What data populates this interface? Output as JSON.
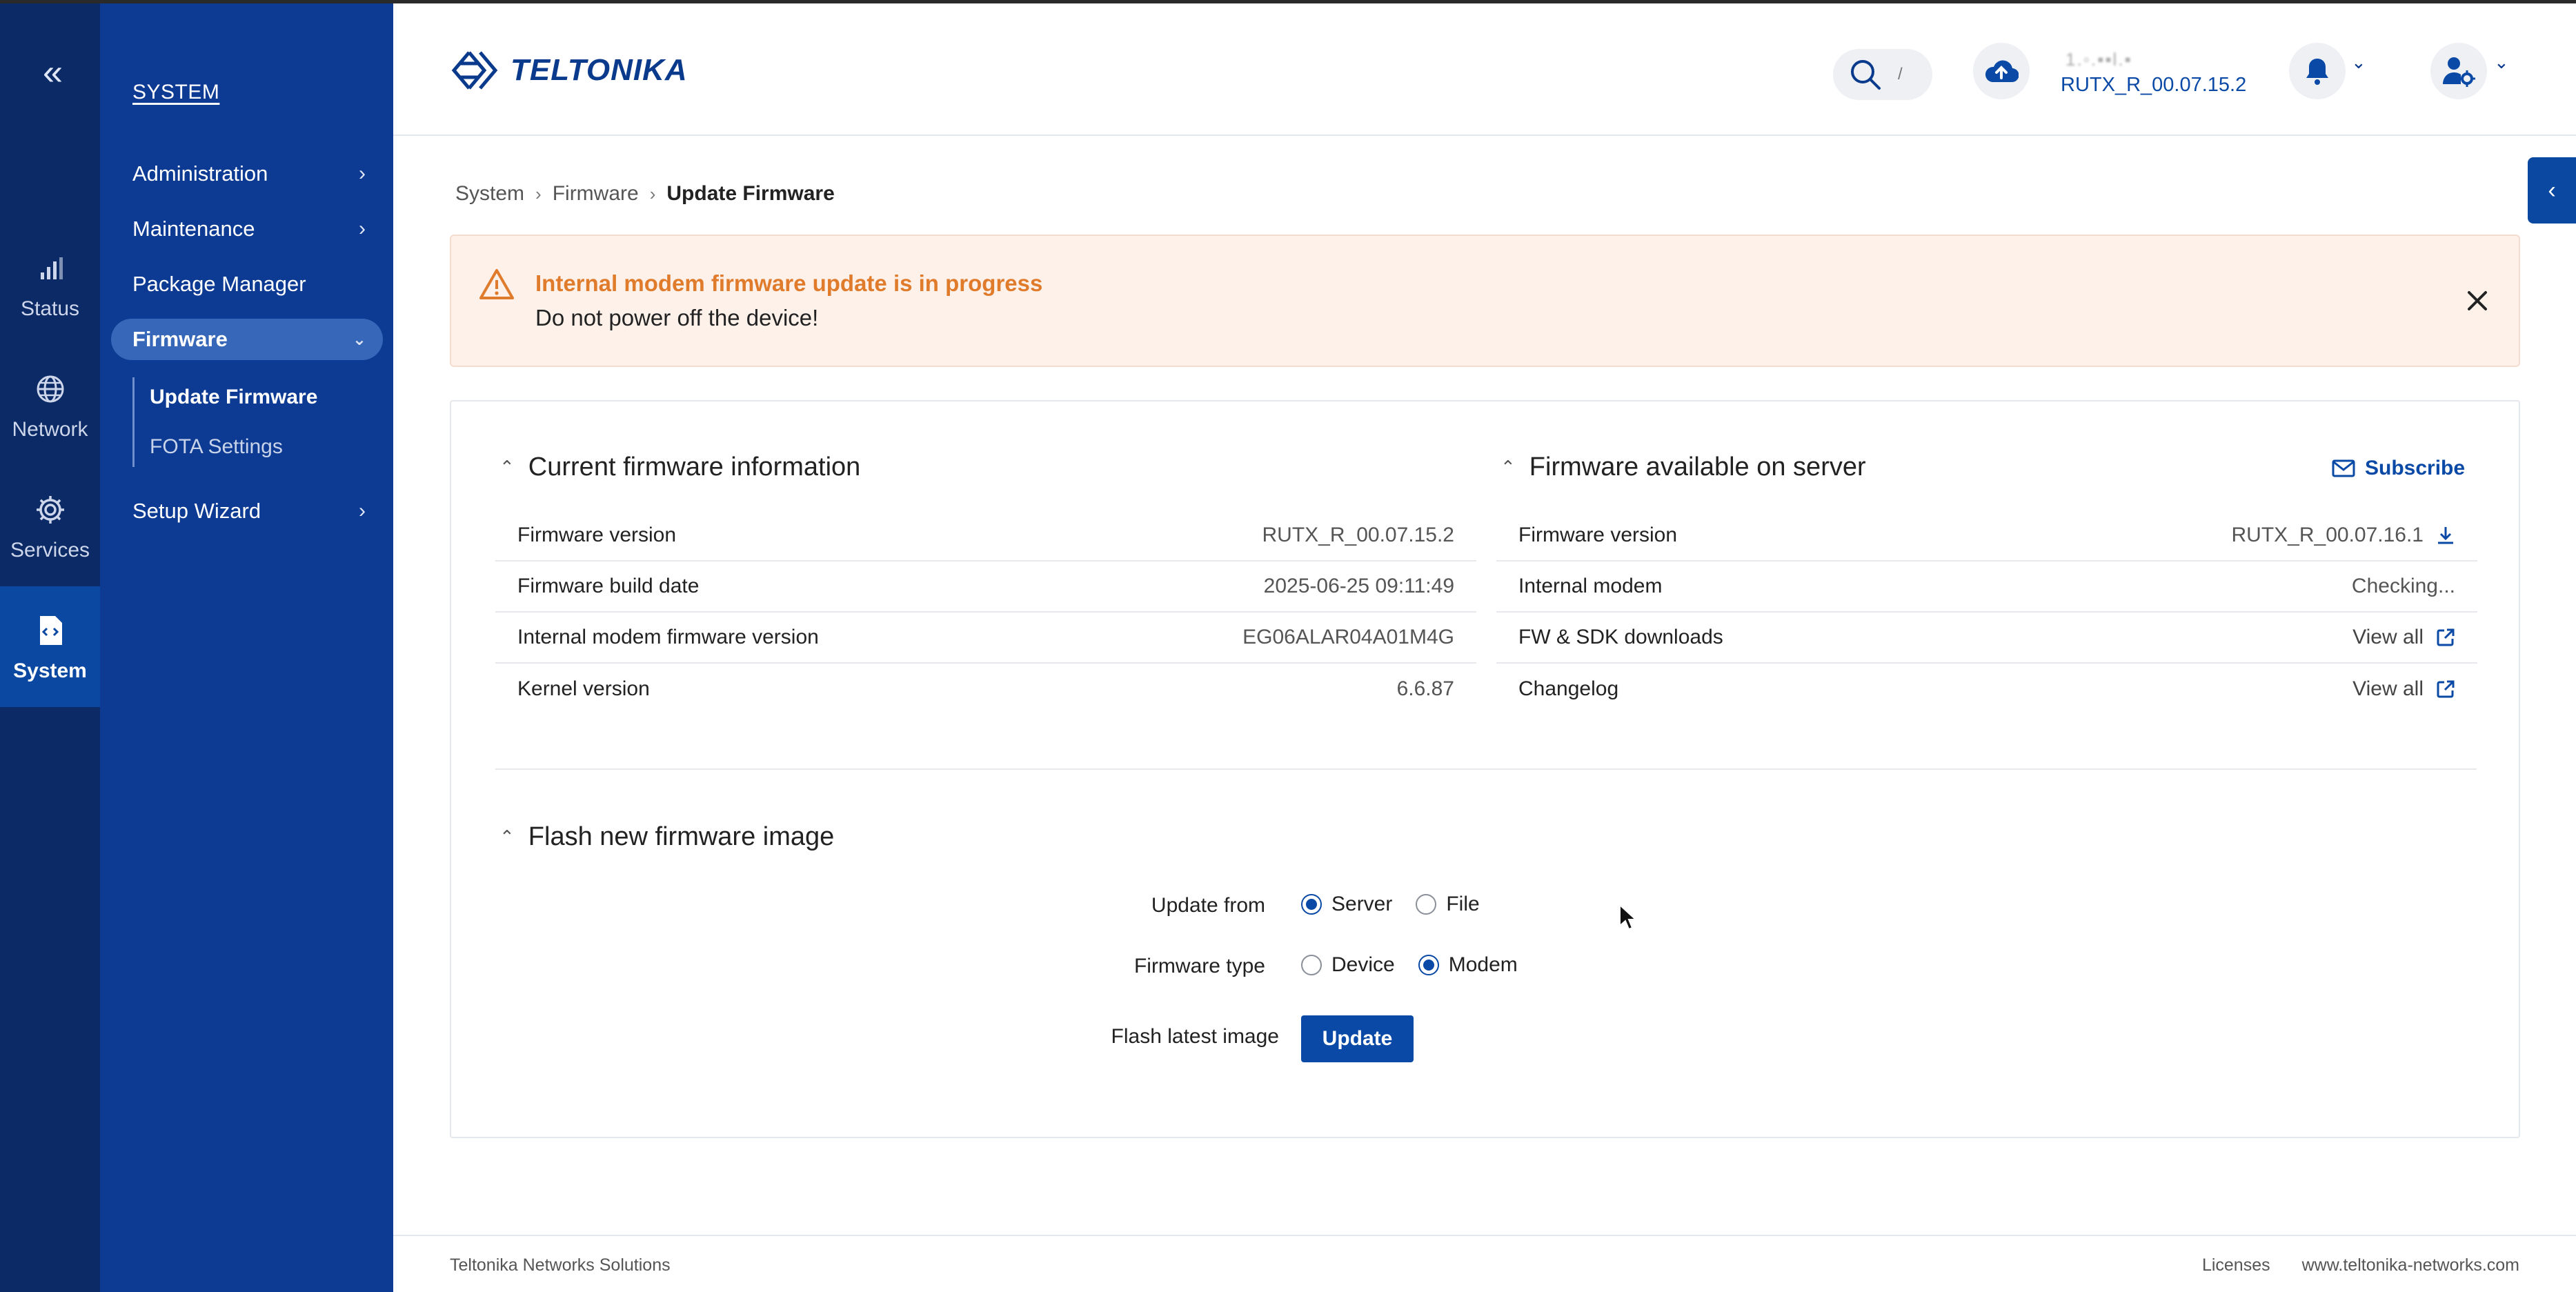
{
  "rail": {
    "items": [
      {
        "label": "Status",
        "icon": "signal-bars-icon"
      },
      {
        "label": "Network",
        "icon": "globe-icon"
      },
      {
        "label": "Services",
        "icon": "gear-icon"
      },
      {
        "label": "System",
        "icon": "system-chip-icon"
      }
    ],
    "active": "System"
  },
  "subnav": {
    "title": "SYSTEM",
    "items": [
      {
        "label": "Administration"
      },
      {
        "label": "Maintenance"
      },
      {
        "label": "Package Manager"
      },
      {
        "label": "Firmware"
      },
      {
        "label": "Setup Wizard"
      }
    ],
    "firmware_children": [
      {
        "label": "Update Firmware"
      },
      {
        "label": "FOTA Settings"
      }
    ]
  },
  "header": {
    "logo_text": "TELTONIKA",
    "search_shortcut": "/",
    "device_name_blurred": "1.◦.▪▪l.▪",
    "firmware_version": "RUTX_R_00.07.15.2"
  },
  "breadcrumb": [
    "System",
    "Firmware",
    "Update Firmware"
  ],
  "alert": {
    "title": "Internal modem firmware update is in progress",
    "text": "Do not power off the device!",
    "color": "#e07b2c"
  },
  "current": {
    "title": "Current firmware information",
    "rows": [
      {
        "label": "Firmware version",
        "value": "RUTX_R_00.07.15.2"
      },
      {
        "label": "Firmware build date",
        "value": "2025-06-25 09:11:49"
      },
      {
        "label": "Internal modem firmware version",
        "value": "EG06ALAR04A01M4G"
      },
      {
        "label": "Kernel version",
        "value": "6.6.87"
      }
    ]
  },
  "server": {
    "title": "Firmware available on server",
    "subscribe_label": "Subscribe",
    "rows": [
      {
        "label": "Firmware version",
        "value": "RUTX_R_00.07.16.1"
      },
      {
        "label": "Internal modem",
        "value": "Checking..."
      },
      {
        "label": "FW & SDK downloads",
        "value": "View all"
      },
      {
        "label": "Changelog",
        "value": "View all"
      }
    ]
  },
  "flash": {
    "title": "Flash new firmware image",
    "update_from_label": "Update from",
    "update_from_options": [
      "Server",
      "File"
    ],
    "update_from_selected": "Server",
    "firmware_type_label": "Firmware type",
    "firmware_type_options": [
      "Device",
      "Modem"
    ],
    "firmware_type_selected": "Modem",
    "flash_latest_label": "Flash latest image",
    "update_button": "Update"
  },
  "footer": {
    "company": "Teltonika Networks Solutions",
    "licenses": "Licenses",
    "website": "www.teltonika-networks.com"
  },
  "colors": {
    "rail_bg": "#0c2a66",
    "subnav_bg": "#0d3b93",
    "accent": "#0a4aa6",
    "alert_bg": "#fdf1ea"
  }
}
